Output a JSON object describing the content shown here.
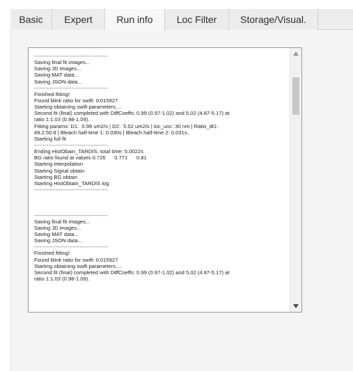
{
  "tabs": [
    {
      "label": "Basic"
    },
    {
      "label": "Expert"
    },
    {
      "label": "Run info"
    },
    {
      "label": "Loc Filter"
    },
    {
      "label": "Storage/Visual."
    }
  ],
  "active_tab": "Run info",
  "log": {
    "lines": [
      "------------------------------------------",
      "Saving final fit images...",
      "Saving JD images...",
      "Saving MAT data...",
      "Saving JSON data...",
      "------------------------------------------",
      "Finished fitting!",
      "Found blink ratio for swift: 0.015927",
      "Starting obtaining swift parameters....",
      "Second fit (final) completed with DiffCoeffs: 0.99 (0.97-1.02) and 5.02 (4.87-5.17) at",
      "ratio 1:1.03 (0.98-1.09).",
      "Fitting params: D1:  0.99 um2/s | D2:  5.02 um2/s | loc_unc: 30 nm | Ratio_dt1:",
      "49.2:50.8 | Bleach half-time 1: 0.030s | Bleach half-time 2: 0.031s..",
      "Starting full fit",
      "------------------------------------------",
      "Ending HistObain_TARDIS, total time: 5.0022s",
      "BG ratio found at values 0.726      0.771      0.81",
      "Starting Interpolation",
      "Starting Signal obtain",
      "Starting BG obtain",
      "Starting HistObtain_TARDIS log",
      "------------------------------------------",
      "",
      "",
      "",
      "------------------------------------------",
      "Saving final fit images...",
      "Saving JD images...",
      "Saving MAT data...",
      "Saving JSON data...",
      "------------------------------------------",
      "Finished fitting!",
      "Found blink ratio for swift: 0.015927",
      "Starting obtaining swift parameters....",
      "Second fit (final) completed with DiffCoeffs: 0.99 (0.97-1.02) and 5.02 (4.87-5.17) at",
      "ratio 1:1.03 (0.98-1.09)."
    ]
  },
  "icons": {
    "scroll_up": "up-arrow-icon",
    "scroll_down": "down-arrow-icon"
  },
  "colors": {
    "tab_bg": "#ececec",
    "active_tab_bg": "#f7f7f7",
    "panel_bg": "#f4f4f4",
    "log_border": "#9a9a9a",
    "scroll_thumb": "#c7c7c7"
  }
}
